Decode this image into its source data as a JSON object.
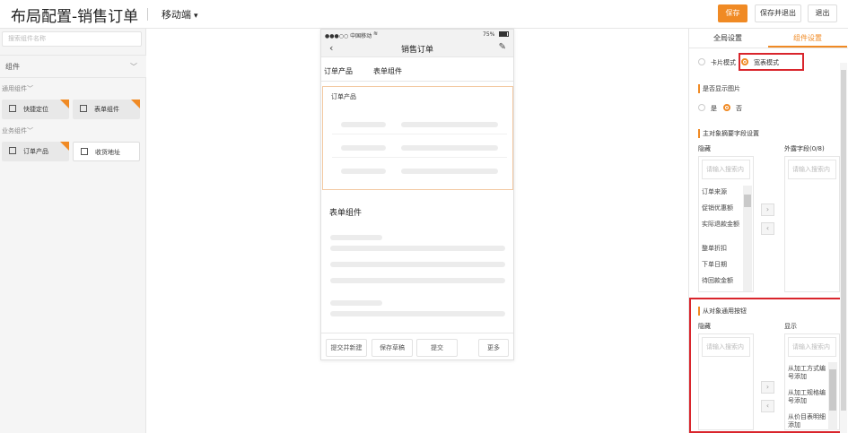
{
  "header": {
    "title": "布局配置-销售订单",
    "mode": "移动端",
    "save": "保存",
    "save_exit": "保存并退出",
    "exit": "退出"
  },
  "left": {
    "search_placeholder": "搜索组件名称",
    "group": "组件",
    "common_section": "通用组件",
    "business_section": "业务组件",
    "common_items": [
      "快捷定位",
      "表单组件"
    ],
    "business_items": [
      "订单产品",
      "收货地址"
    ]
  },
  "phone": {
    "carrier": "●●●○○ 中国移动",
    "battery": "75%",
    "title": "销售订单",
    "tabs": [
      "订单产品",
      "表单组件"
    ],
    "section1": "订单产品",
    "section2": "表单组件",
    "buttons": [
      "提交并新建",
      "保存草稿",
      "提交",
      "更多"
    ]
  },
  "right": {
    "tabs": [
      "全局设置",
      "组件设置"
    ],
    "modes": [
      "卡片模式",
      "宽表模式"
    ],
    "show_image_label": "是否显示图片",
    "yes": "是",
    "no": "否",
    "summary_label": "主对象摘要字段设置",
    "hidden_label": "隐藏",
    "external_label": "外露字段(0/8)",
    "search_placeholder": "请输入搜索内",
    "hidden_fields": [
      "订单来源",
      "促销优惠额",
      "实际退款金额",
      "整单折扣",
      "下单日期",
      "待回款金额"
    ],
    "common_buttons_label": "从对象通用按钮",
    "show_label": "显示",
    "show_buttons": [
      "从加工方式编号添加",
      "从加工规格编号添加",
      "从价目表明细添加"
    ]
  },
  "colors": {
    "accent": "#f08a24",
    "highlight": "#d9252c"
  }
}
